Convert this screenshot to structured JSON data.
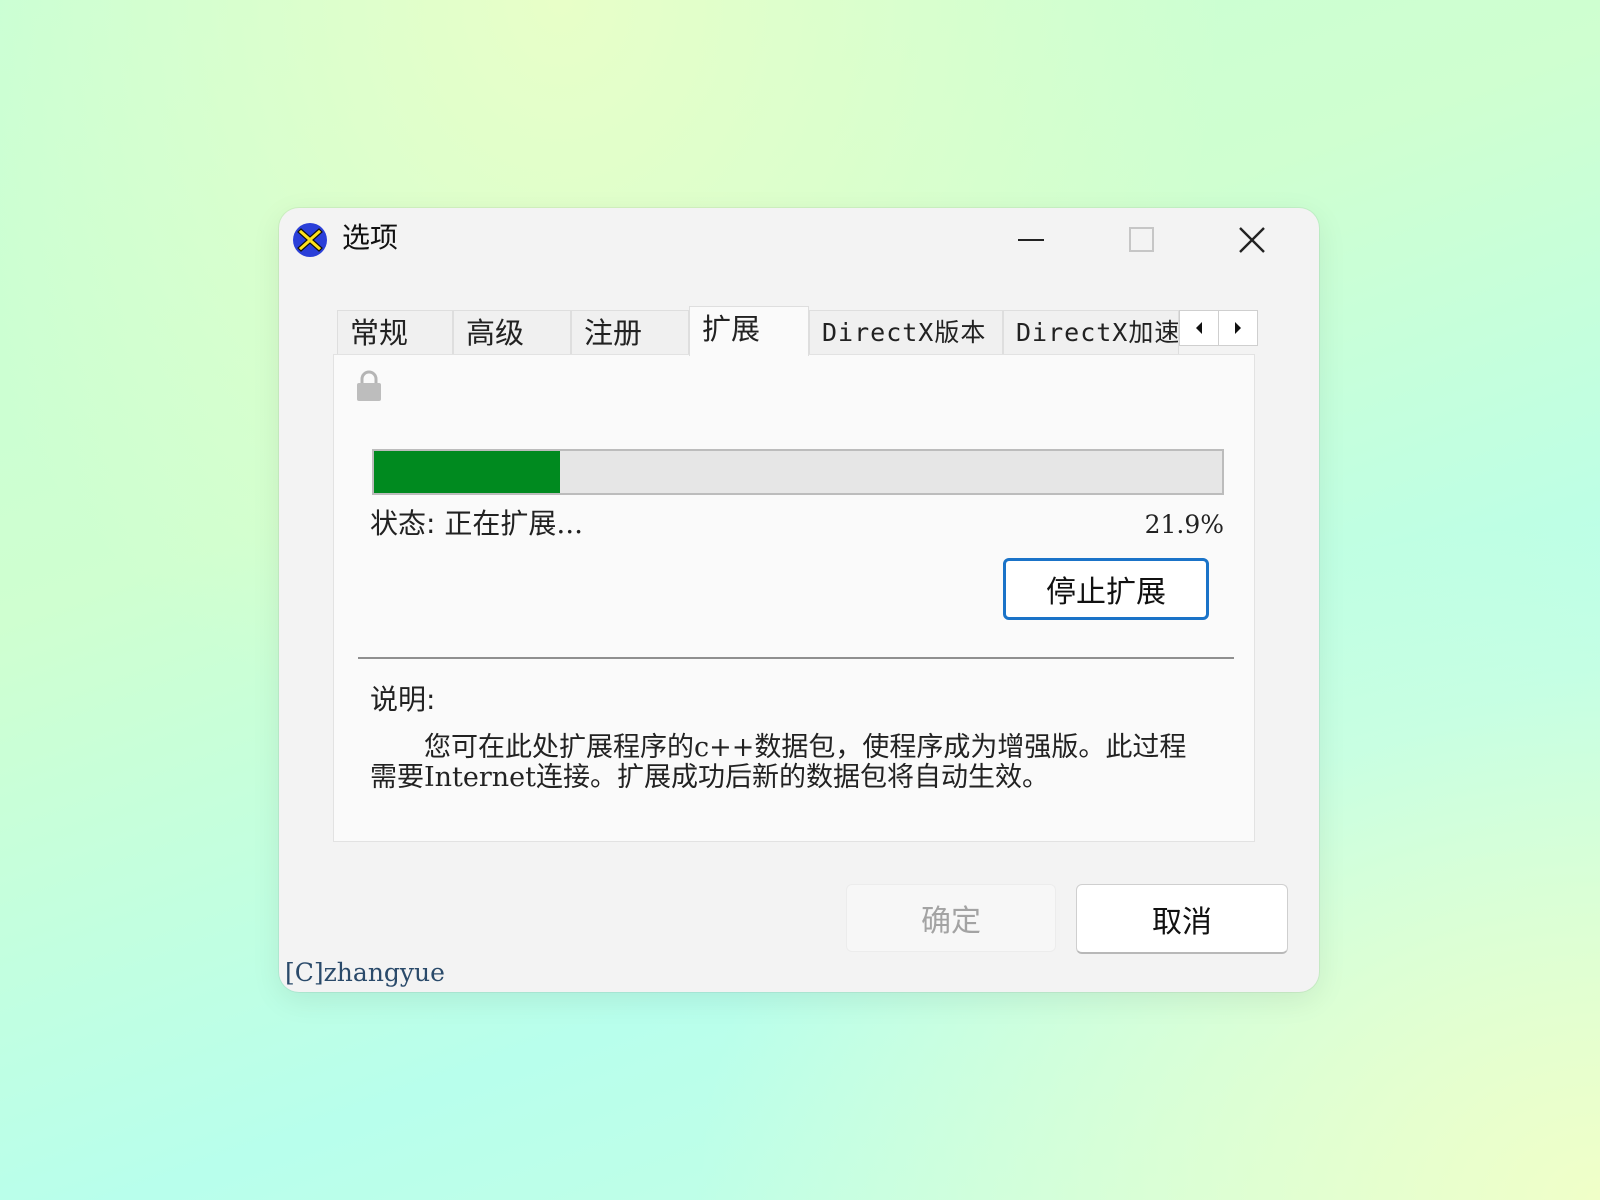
{
  "window": {
    "title": "选项",
    "icon": "xfire-x-icon",
    "controls": {
      "minimize": "minimize-icon",
      "maximize": "maximize-icon",
      "close": "close-icon"
    }
  },
  "tabs": [
    {
      "label": "常规",
      "active": false
    },
    {
      "label": "高级",
      "active": false
    },
    {
      "label": "注册",
      "active": false
    },
    {
      "label": "扩展",
      "active": true
    },
    {
      "label": "DirectX版本",
      "active": false
    },
    {
      "label": "DirectX加速",
      "active": false
    }
  ],
  "tab_scroll": {
    "left": "arrow-left-icon",
    "right": "arrow-right-icon"
  },
  "extension": {
    "lock_icon": "lock-icon",
    "progress": {
      "value": 0.219,
      "percent_text": "21.9%",
      "fill_color": "#008a1f"
    },
    "status_label": "状态:",
    "status_value": "正在扩展...",
    "stop_button": "停止扩展",
    "description_title": "说明:",
    "description_text": "您可在此处扩展程序的c++数据包，使程序成为增强版。此过程需要Internet连接。扩展成功后新的数据包将自动生效。"
  },
  "footer": {
    "ok_button": "确定",
    "ok_enabled": false,
    "cancel_button": "取消",
    "copyright": "[C]zhangyue"
  },
  "colors": {
    "accent_border": "#1a73c8",
    "progress_fill": "#008a1f"
  }
}
